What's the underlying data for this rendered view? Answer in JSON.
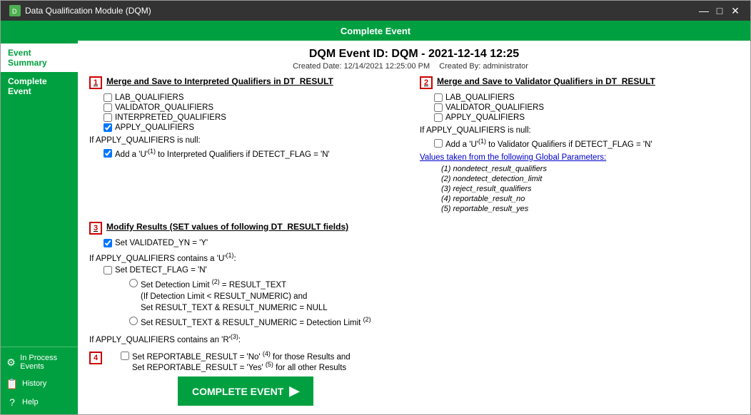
{
  "window": {
    "title": "Data Qualification Module (DQM)",
    "min_btn": "—",
    "max_btn": "□",
    "close_btn": "✕"
  },
  "header": {
    "title": "Complete Event"
  },
  "event": {
    "id_label": "DQM Event ID: DQM - 2021-12-14 12:25",
    "created_date_label": "Created Date: 12/14/2021 12:25:00 PM",
    "created_by_label": "Created By: administrator"
  },
  "sidebar": {
    "items": [
      {
        "label": "Event Summary",
        "active": true
      },
      {
        "label": "Complete Event",
        "active": false
      }
    ],
    "bottom_items": [
      {
        "label": "In Process Events",
        "icon": "⚙"
      },
      {
        "label": "History",
        "icon": "📋"
      },
      {
        "label": "Help",
        "icon": "?"
      }
    ]
  },
  "section1": {
    "badge": "1",
    "title": "Merge and Save to Interpreted Qualifiers in DT_RESULT",
    "checkboxes": [
      {
        "label": "LAB_QUALIFIERS",
        "checked": false
      },
      {
        "label": "VALIDATOR_QUALIFIERS",
        "checked": false
      },
      {
        "label": "INTERPRETED_QUALIFIERS",
        "checked": false
      },
      {
        "label": "APPLY_QUALIFIERS",
        "checked": true
      }
    ],
    "condition": "If APPLY_QUALIFIERS is null:",
    "add_u_label": "Add a 'U'",
    "add_u_sup": "(1)",
    "add_u_rest": " to Interpreted Qualifiers if DETECT_FLAG = 'N'",
    "add_u_checked": true
  },
  "section2": {
    "badge": "2",
    "title": "Merge and Save to Validator Qualifiers in DT_RESULT",
    "checkboxes": [
      {
        "label": "LAB_QUALIFIERS",
        "checked": false
      },
      {
        "label": "VALIDATOR_QUALIFIERS",
        "checked": false
      },
      {
        "label": "APPLY_QUALIFIERS",
        "checked": false
      }
    ],
    "condition": "If APPLY_QUALIFIERS is null:",
    "add_u_label": "Add a 'U'",
    "add_u_sup": "(1)",
    "add_u_rest": " to Validator Qualifiers if DETECT_FLAG = 'N'",
    "add_u_checked": false,
    "global_params_title": "Values taken from the following Global Parameters:",
    "global_params": [
      "(1) nondetect_result_qualifiers",
      "(2) nondetect_detection_limit",
      "(3) reject_result_qualifiers",
      "(4) reportable_result_no",
      "(5) reportable_result_yes"
    ]
  },
  "section3": {
    "badge": "3",
    "title": "Modify Results (SET values of following DT_RESULT fields)",
    "set_validated": "Set VALIDATED_YN = 'Y'",
    "set_validated_checked": true,
    "if_apply_u": "If APPLY_QUALIFIERS contains a 'U'",
    "if_apply_u_sup": "(1)",
    "if_apply_u_rest": ":",
    "set_detect_flag": "Set DETECT_FLAG = 'N'",
    "set_detect_flag_checked": false,
    "radio1_label": "Set Detection Limit",
    "radio1_sup": "(2)",
    "radio1_rest": " = RESULT_TEXT\n(If Detection Limit < RESULT_NUMERIC) and\nSet RESULT_TEXT & RESULT_NUMERIC = NULL",
    "radio1_checked": false,
    "radio2_label": "Set RESULT_TEXT & RESULT_NUMERIC = Detection Limit",
    "radio2_sup": "(2)",
    "radio2_checked": false,
    "if_apply_r": "If APPLY_QUALIFIERS contains an 'R'",
    "if_apply_r_sup": "(3)",
    "if_apply_r_rest": ":"
  },
  "section4": {
    "badge": "4",
    "reportable_label": "Set REPORTABLE_RESULT = 'No'",
    "reportable_sup1": "(4)",
    "reportable_rest": " for those Results and\nSet REPORTABLE_RESULT = 'Yes'",
    "reportable_sup2": "(5)",
    "reportable_rest2": " for all other Results",
    "reportable_checked": false,
    "complete_btn": "COMPLETE EVENT",
    "complete_icon": "▶"
  }
}
